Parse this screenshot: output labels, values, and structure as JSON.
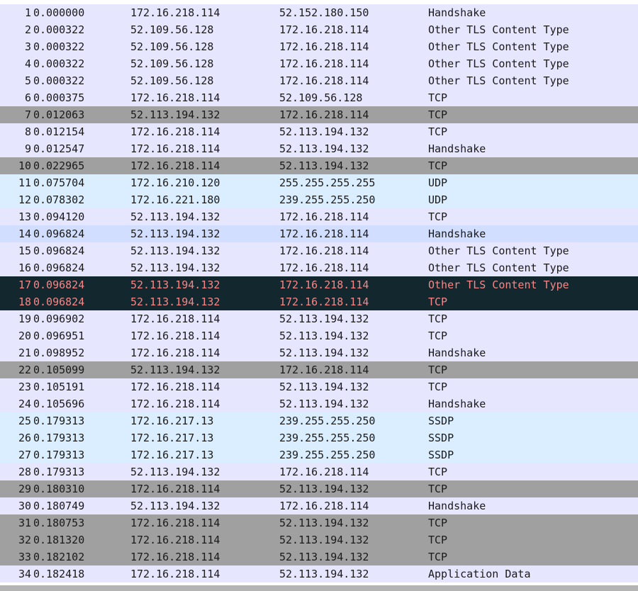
{
  "packets": [
    {
      "no": "1",
      "time": "0.000000",
      "src": "172.16.218.114",
      "dst": "52.152.180.150",
      "info": "Handshake",
      "color": "tcp"
    },
    {
      "no": "2",
      "time": "0.000322",
      "src": "52.109.56.128",
      "dst": "172.16.218.114",
      "info": "Other TLS Content Type",
      "color": "tcp"
    },
    {
      "no": "3",
      "time": "0.000322",
      "src": "52.109.56.128",
      "dst": "172.16.218.114",
      "info": "Other TLS Content Type",
      "color": "tcp"
    },
    {
      "no": "4",
      "time": "0.000322",
      "src": "52.109.56.128",
      "dst": "172.16.218.114",
      "info": "Other TLS Content Type",
      "color": "tcp"
    },
    {
      "no": "5",
      "time": "0.000322",
      "src": "52.109.56.128",
      "dst": "172.16.218.114",
      "info": "Other TLS Content Type",
      "color": "tcp"
    },
    {
      "no": "6",
      "time": "0.000375",
      "src": "172.16.218.114",
      "dst": "52.109.56.128",
      "info": "TCP",
      "color": "tcp"
    },
    {
      "no": "7",
      "time": "0.012063",
      "src": "52.113.194.132",
      "dst": "172.16.218.114",
      "info": "TCP",
      "color": "bad"
    },
    {
      "no": "8",
      "time": "0.012154",
      "src": "172.16.218.114",
      "dst": "52.113.194.132",
      "info": "TCP",
      "color": "tcp"
    },
    {
      "no": "9",
      "time": "0.012547",
      "src": "172.16.218.114",
      "dst": "52.113.194.132",
      "info": "Handshake",
      "color": "tcp"
    },
    {
      "no": "10",
      "time": "0.022965",
      "src": "172.16.218.114",
      "dst": "52.113.194.132",
      "info": "TCP",
      "color": "bad"
    },
    {
      "no": "11",
      "time": "0.075704",
      "src": "172.16.210.120",
      "dst": "255.255.255.255",
      "info": "UDP",
      "color": "udp"
    },
    {
      "no": "12",
      "time": "0.078302",
      "src": "172.16.221.180",
      "dst": "239.255.255.250",
      "info": "UDP",
      "color": "udp"
    },
    {
      "no": "13",
      "time": "0.094120",
      "src": "52.113.194.132",
      "dst": "172.16.218.114",
      "info": "TCP",
      "color": "tcp"
    },
    {
      "no": "14",
      "time": "0.096824",
      "src": "52.113.194.132",
      "dst": "172.16.218.114",
      "info": "Handshake",
      "color": "hs"
    },
    {
      "no": "15",
      "time": "0.096824",
      "src": "52.113.194.132",
      "dst": "172.16.218.114",
      "info": "Other TLS Content Type",
      "color": "tcp"
    },
    {
      "no": "16",
      "time": "0.096824",
      "src": "52.113.194.132",
      "dst": "172.16.218.114",
      "info": "Other TLS Content Type",
      "color": "tcp"
    },
    {
      "no": "17",
      "time": "0.096824",
      "src": "52.113.194.132",
      "dst": "172.16.218.114",
      "info": "Other TLS Content Type",
      "color": "sel"
    },
    {
      "no": "18",
      "time": "0.096824",
      "src": "52.113.194.132",
      "dst": "172.16.218.114",
      "info": "TCP",
      "color": "sel"
    },
    {
      "no": "19",
      "time": "0.096902",
      "src": "172.16.218.114",
      "dst": "52.113.194.132",
      "info": "TCP",
      "color": "tcp"
    },
    {
      "no": "20",
      "time": "0.096951",
      "src": "172.16.218.114",
      "dst": "52.113.194.132",
      "info": "TCP",
      "color": "tcp"
    },
    {
      "no": "21",
      "time": "0.098952",
      "src": "172.16.218.114",
      "dst": "52.113.194.132",
      "info": "Handshake",
      "color": "tcp"
    },
    {
      "no": "22",
      "time": "0.105099",
      "src": "52.113.194.132",
      "dst": "172.16.218.114",
      "info": "TCP",
      "color": "bad"
    },
    {
      "no": "23",
      "time": "0.105191",
      "src": "172.16.218.114",
      "dst": "52.113.194.132",
      "info": "TCP",
      "color": "tcp"
    },
    {
      "no": "24",
      "time": "0.105696",
      "src": "172.16.218.114",
      "dst": "52.113.194.132",
      "info": "Handshake",
      "color": "tcp"
    },
    {
      "no": "25",
      "time": "0.179313",
      "src": "172.16.217.13",
      "dst": "239.255.255.250",
      "info": "SSDP",
      "color": "udp"
    },
    {
      "no": "26",
      "time": "0.179313",
      "src": "172.16.217.13",
      "dst": "239.255.255.250",
      "info": "SSDP",
      "color": "udp"
    },
    {
      "no": "27",
      "time": "0.179313",
      "src": "172.16.217.13",
      "dst": "239.255.255.250",
      "info": "SSDP",
      "color": "udp"
    },
    {
      "no": "28",
      "time": "0.179313",
      "src": "52.113.194.132",
      "dst": "172.16.218.114",
      "info": "TCP",
      "color": "tcp"
    },
    {
      "no": "29",
      "time": "0.180310",
      "src": "172.16.218.114",
      "dst": "52.113.194.132",
      "info": "TCP",
      "color": "bad"
    },
    {
      "no": "30",
      "time": "0.180749",
      "src": "52.113.194.132",
      "dst": "172.16.218.114",
      "info": "Handshake",
      "color": "tcp"
    },
    {
      "no": "31",
      "time": "0.180753",
      "src": "172.16.218.114",
      "dst": "52.113.194.132",
      "info": "TCP",
      "color": "bad"
    },
    {
      "no": "32",
      "time": "0.181320",
      "src": "172.16.218.114",
      "dst": "52.113.194.132",
      "info": "TCP",
      "color": "bad"
    },
    {
      "no": "33",
      "time": "0.182102",
      "src": "172.16.218.114",
      "dst": "52.113.194.132",
      "info": "TCP",
      "color": "bad"
    },
    {
      "no": "34",
      "time": "0.182418",
      "src": "172.16.218.114",
      "dst": "52.113.194.132",
      "info": "Application Data",
      "color": "tcp"
    }
  ],
  "colors": {
    "tcp": "#e7e6ff",
    "bad": "#a0a0a0",
    "udp": "#daeeff",
    "hs": "#d2deff",
    "sel": "#12272e",
    "sel_text": "#f78787"
  }
}
